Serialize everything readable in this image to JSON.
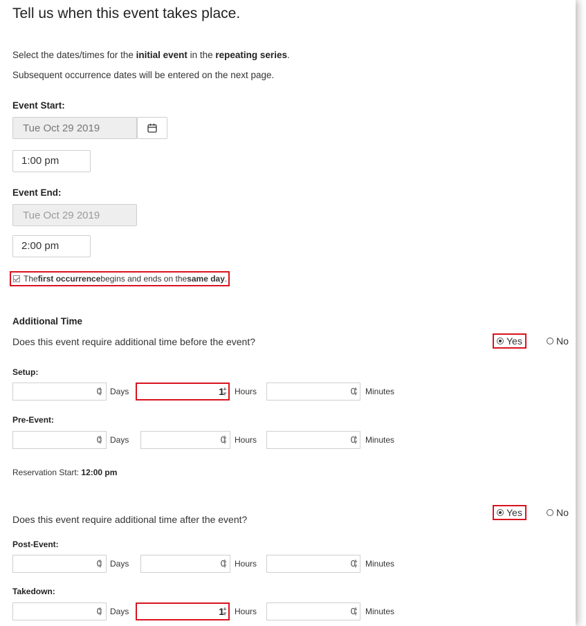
{
  "heading": "Tell us when this event takes place.",
  "intro": {
    "line1": [
      "Select the dates/times for the ",
      "initial event",
      " in the ",
      "repeating series",
      "."
    ],
    "line2": "Subsequent occurrence dates will be entered on the next page."
  },
  "event_start": {
    "label": "Event Start:",
    "date": "Tue Oct 29 2019",
    "time": "1:00 pm"
  },
  "event_end": {
    "label": "Event End:",
    "date": "Tue Oct 29 2019",
    "time": "2:00 pm"
  },
  "same_day": {
    "checked": true,
    "parts": [
      "The ",
      "first occurrence",
      " begins and ends on the ",
      "same day",
      "."
    ]
  },
  "additional_time": {
    "label": "Additional Time",
    "before_question": "Does this event require additional time before the event?",
    "after_question": "Does this event require additional time after the event?",
    "yes_label": "Yes",
    "no_label": "No",
    "before_selected": "Yes",
    "after_selected": "Yes",
    "reservation_start_label": "Reservation Start:",
    "reservation_start_value": "12:00 pm",
    "units": {
      "days": "Days",
      "hours": "Hours",
      "minutes": "Minutes"
    },
    "setup": {
      "label": "Setup:",
      "days": "0",
      "hours": "1",
      "minutes": "0"
    },
    "pre_event": {
      "label": "Pre-Event:",
      "days": "0",
      "hours": "0",
      "minutes": "0"
    },
    "post_event": {
      "label": "Post-Event:",
      "days": "0",
      "hours": "0",
      "minutes": "0"
    },
    "takedown": {
      "label": "Takedown:",
      "days": "0",
      "hours": "1",
      "minutes": "0"
    }
  },
  "colors": {
    "highlight": "#d9121f",
    "disabled_bg": "#eeeeee",
    "text": "#333333"
  },
  "icons": {
    "calendar": "calendar-icon",
    "spinner": "spinner-arrows-icon"
  }
}
